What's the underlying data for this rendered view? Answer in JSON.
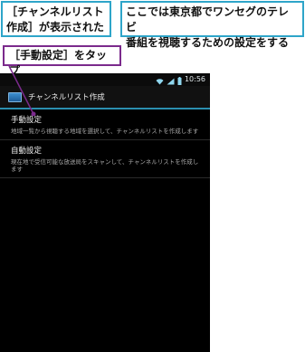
{
  "annotations": {
    "callout_list_shown": "［チャンネルリスト\n作成］が表示された",
    "callout_description": "ここでは東京都でワンセグのテレビ\n番組を視聴するための設定をする",
    "callout_tap": "［手動設定］をタップ"
  },
  "colors": {
    "callout_border": "#2ea5c9",
    "tap_callout_border": "#7b2a8c",
    "pointer": "#7b2a8c",
    "accent_line": "#2b8fb0"
  },
  "status_bar": {
    "icons": [
      "wifi-icon",
      "signal-icon",
      "battery-icon"
    ],
    "time": "10:56"
  },
  "app_bar": {
    "icon": "tv-app-icon",
    "title": "チャンネルリスト作成"
  },
  "list": {
    "items": [
      {
        "label": "手動設定",
        "description": "地域一覧から視聴する地域を選択して、チャンネルリストを作成します"
      },
      {
        "label": "自動設定",
        "description": "現在地で受信可能な放送局をスキャンして、チャンネルリストを作成します"
      }
    ]
  }
}
